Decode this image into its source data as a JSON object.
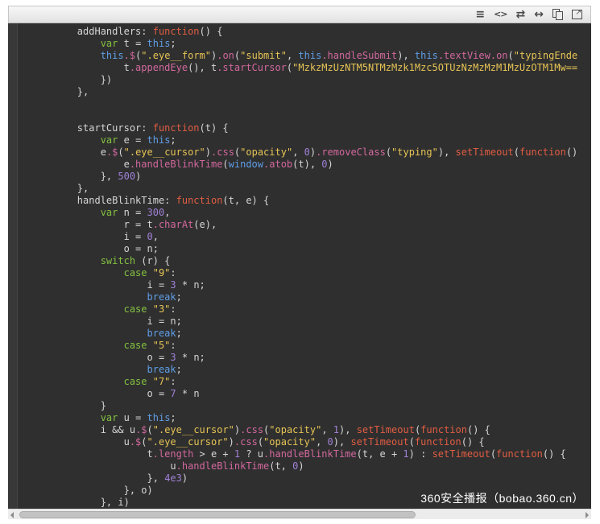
{
  "colors": {
    "bg": "#2f2f2f",
    "plain": "#d6d6d6",
    "keyword": "#e25d43",
    "declaration": "#84c141",
    "builtin": "#5f9ee6",
    "string": "#e6c455",
    "number": "#a081d6",
    "method": "#d2689e",
    "toolbar_bg": "#ececec",
    "watermark": "#ffffff"
  },
  "toolbar": {
    "icons": [
      {
        "name": "line-numbers-icon",
        "glyph": "≡"
      },
      {
        "name": "plain-code-icon",
        "glyph": "<>"
      },
      {
        "name": "toggle-line-wrap-icon",
        "glyph": "⇄"
      },
      {
        "name": "expand-code-icon",
        "glyph": "↔"
      },
      {
        "name": "copy-icon"
      },
      {
        "name": "open-new-window-icon",
        "glyph": "↗"
      }
    ]
  },
  "watermark": {
    "text": "360安全播报（bobao.360.cn）"
  },
  "code": {
    "lines": [
      {
        "indent": 2,
        "tokens": [
          [
            "plain",
            "addHandlers: "
          ],
          [
            "keyword",
            "function"
          ],
          [
            "plain",
            "() {"
          ]
        ]
      },
      {
        "indent": 3,
        "tokens": [
          [
            "declaration",
            "var"
          ],
          [
            "plain",
            " t = "
          ],
          [
            "builtin",
            "this"
          ],
          [
            "plain",
            ";"
          ]
        ]
      },
      {
        "indent": 3,
        "tokens": [
          [
            "builtin",
            "this"
          ],
          [
            "method",
            ".$"
          ],
          [
            "plain",
            "("
          ],
          [
            "string",
            "\".eye__form\""
          ],
          [
            "plain",
            ")"
          ],
          [
            "method",
            ".on"
          ],
          [
            "plain",
            "("
          ],
          [
            "string",
            "\"submit\""
          ],
          [
            "plain",
            ", "
          ],
          [
            "builtin",
            "this"
          ],
          [
            "method",
            ".handleSubmit"
          ],
          [
            "plain",
            "), "
          ],
          [
            "builtin",
            "this"
          ],
          [
            "method",
            ".textView.on"
          ],
          [
            "plain",
            "("
          ],
          [
            "string",
            "\"typingEnde"
          ]
        ]
      },
      {
        "indent": 4,
        "tokens": [
          [
            "plain",
            "t"
          ],
          [
            "method",
            ".appendEye"
          ],
          [
            "plain",
            "(), t"
          ],
          [
            "method",
            ".startCursor"
          ],
          [
            "plain",
            "("
          ],
          [
            "string",
            "\"MzkzMzUzNTM5NTMzMzk1Mzc5OTUzNzMzMzM1MzUzOTM1Mw=="
          ]
        ]
      },
      {
        "indent": 3,
        "tokens": [
          [
            "plain",
            "})"
          ]
        ]
      },
      {
        "indent": 2,
        "tokens": [
          [
            "plain",
            "},"
          ]
        ]
      },
      {
        "indent": 0,
        "tokens": []
      },
      {
        "indent": 0,
        "tokens": []
      },
      {
        "indent": 2,
        "tokens": [
          [
            "plain",
            "startCursor: "
          ],
          [
            "keyword",
            "function"
          ],
          [
            "plain",
            "(t) {"
          ]
        ]
      },
      {
        "indent": 3,
        "tokens": [
          [
            "declaration",
            "var"
          ],
          [
            "plain",
            " e = "
          ],
          [
            "builtin",
            "this"
          ],
          [
            "plain",
            ";"
          ]
        ]
      },
      {
        "indent": 3,
        "tokens": [
          [
            "plain",
            "e"
          ],
          [
            "method",
            ".$"
          ],
          [
            "plain",
            "("
          ],
          [
            "string",
            "\".eye__cursor\""
          ],
          [
            "plain",
            ")"
          ],
          [
            "method",
            ".css"
          ],
          [
            "plain",
            "("
          ],
          [
            "string",
            "\"opacity\""
          ],
          [
            "plain",
            ", "
          ],
          [
            "number",
            "0"
          ],
          [
            "plain",
            ")"
          ],
          [
            "method",
            ".removeClass"
          ],
          [
            "plain",
            "("
          ],
          [
            "string",
            "\"typing\""
          ],
          [
            "plain",
            "), "
          ],
          [
            "keyword",
            "setTimeout"
          ],
          [
            "plain",
            "("
          ],
          [
            "keyword",
            "function"
          ],
          [
            "plain",
            "()"
          ]
        ]
      },
      {
        "indent": 4,
        "tokens": [
          [
            "plain",
            "e"
          ],
          [
            "method",
            ".handleBlinkTime"
          ],
          [
            "plain",
            "("
          ],
          [
            "builtin",
            "window"
          ],
          [
            "method",
            ".atob"
          ],
          [
            "plain",
            "(t), "
          ],
          [
            "number",
            "0"
          ],
          [
            "plain",
            ")"
          ]
        ]
      },
      {
        "indent": 3,
        "tokens": [
          [
            "plain",
            "}, "
          ],
          [
            "number",
            "500"
          ],
          [
            "plain",
            ")"
          ]
        ]
      },
      {
        "indent": 2,
        "tokens": [
          [
            "plain",
            "},"
          ]
        ]
      },
      {
        "indent": 2,
        "tokens": [
          [
            "plain",
            "handleBlinkTime: "
          ],
          [
            "keyword",
            "function"
          ],
          [
            "plain",
            "(t, e) {"
          ]
        ]
      },
      {
        "indent": 3,
        "tokens": [
          [
            "declaration",
            "var"
          ],
          [
            "plain",
            " n = "
          ],
          [
            "number",
            "300"
          ],
          [
            "plain",
            ","
          ]
        ]
      },
      {
        "indent": 4,
        "tokens": [
          [
            "plain",
            "r = t"
          ],
          [
            "method",
            ".charAt"
          ],
          [
            "plain",
            "(e),"
          ]
        ]
      },
      {
        "indent": 4,
        "tokens": [
          [
            "plain",
            "i = "
          ],
          [
            "number",
            "0"
          ],
          [
            "plain",
            ","
          ]
        ]
      },
      {
        "indent": 4,
        "tokens": [
          [
            "plain",
            "o = n;"
          ]
        ]
      },
      {
        "indent": 3,
        "tokens": [
          [
            "declaration",
            "switch"
          ],
          [
            "plain",
            " (r) {"
          ]
        ]
      },
      {
        "indent": 4,
        "tokens": [
          [
            "declaration",
            "case"
          ],
          [
            "plain",
            " "
          ],
          [
            "string",
            "\"9\""
          ],
          [
            "plain",
            ":"
          ]
        ]
      },
      {
        "indent": 5,
        "tokens": [
          [
            "plain",
            "i = "
          ],
          [
            "number",
            "3"
          ],
          [
            "plain",
            " * n;"
          ]
        ]
      },
      {
        "indent": 5,
        "tokens": [
          [
            "builtin",
            "break"
          ],
          [
            "plain",
            ";"
          ]
        ]
      },
      {
        "indent": 4,
        "tokens": [
          [
            "declaration",
            "case"
          ],
          [
            "plain",
            " "
          ],
          [
            "string",
            "\"3\""
          ],
          [
            "plain",
            ":"
          ]
        ]
      },
      {
        "indent": 5,
        "tokens": [
          [
            "plain",
            "i = n;"
          ]
        ]
      },
      {
        "indent": 5,
        "tokens": [
          [
            "builtin",
            "break"
          ],
          [
            "plain",
            ";"
          ]
        ]
      },
      {
        "indent": 4,
        "tokens": [
          [
            "declaration",
            "case"
          ],
          [
            "plain",
            " "
          ],
          [
            "string",
            "\"5\""
          ],
          [
            "plain",
            ":"
          ]
        ]
      },
      {
        "indent": 5,
        "tokens": [
          [
            "plain",
            "o = "
          ],
          [
            "number",
            "3"
          ],
          [
            "plain",
            " * n;"
          ]
        ]
      },
      {
        "indent": 5,
        "tokens": [
          [
            "builtin",
            "break"
          ],
          [
            "plain",
            ";"
          ]
        ]
      },
      {
        "indent": 4,
        "tokens": [
          [
            "declaration",
            "case"
          ],
          [
            "plain",
            " "
          ],
          [
            "string",
            "\"7\""
          ],
          [
            "plain",
            ":"
          ]
        ]
      },
      {
        "indent": 5,
        "tokens": [
          [
            "plain",
            "o = "
          ],
          [
            "number",
            "7"
          ],
          [
            "plain",
            " * n"
          ]
        ]
      },
      {
        "indent": 3,
        "tokens": [
          [
            "plain",
            "}"
          ]
        ]
      },
      {
        "indent": 3,
        "tokens": [
          [
            "declaration",
            "var"
          ],
          [
            "plain",
            " u = "
          ],
          [
            "builtin",
            "this"
          ],
          [
            "plain",
            ";"
          ]
        ]
      },
      {
        "indent": 3,
        "tokens": [
          [
            "plain",
            "i && u"
          ],
          [
            "method",
            ".$"
          ],
          [
            "plain",
            "("
          ],
          [
            "string",
            "\".eye__cursor\""
          ],
          [
            "plain",
            ")"
          ],
          [
            "method",
            ".css"
          ],
          [
            "plain",
            "("
          ],
          [
            "string",
            "\"opacity\""
          ],
          [
            "plain",
            ", "
          ],
          [
            "number",
            "1"
          ],
          [
            "plain",
            "), "
          ],
          [
            "keyword",
            "setTimeout"
          ],
          [
            "plain",
            "("
          ],
          [
            "keyword",
            "function"
          ],
          [
            "plain",
            "() {"
          ]
        ]
      },
      {
        "indent": 4,
        "tokens": [
          [
            "plain",
            "u"
          ],
          [
            "method",
            ".$"
          ],
          [
            "plain",
            "("
          ],
          [
            "string",
            "\".eye__cursor\""
          ],
          [
            "plain",
            ")"
          ],
          [
            "method",
            ".css"
          ],
          [
            "plain",
            "("
          ],
          [
            "string",
            "\"opacity\""
          ],
          [
            "plain",
            ", "
          ],
          [
            "number",
            "0"
          ],
          [
            "plain",
            "), "
          ],
          [
            "keyword",
            "setTimeout"
          ],
          [
            "plain",
            "("
          ],
          [
            "keyword",
            "function"
          ],
          [
            "plain",
            "() {"
          ]
        ]
      },
      {
        "indent": 5,
        "tokens": [
          [
            "plain",
            "t"
          ],
          [
            "method",
            ".length"
          ],
          [
            "plain",
            " > e + "
          ],
          [
            "number",
            "1"
          ],
          [
            "plain",
            " ? u"
          ],
          [
            "method",
            ".handleBlinkTime"
          ],
          [
            "plain",
            "(t, e + "
          ],
          [
            "number",
            "1"
          ],
          [
            "plain",
            ") : "
          ],
          [
            "keyword",
            "setTimeout"
          ],
          [
            "plain",
            "("
          ],
          [
            "keyword",
            "function"
          ],
          [
            "plain",
            "() {"
          ]
        ]
      },
      {
        "indent": 6,
        "tokens": [
          [
            "plain",
            "u"
          ],
          [
            "method",
            ".handleBlinkTime"
          ],
          [
            "plain",
            "(t, "
          ],
          [
            "number",
            "0"
          ],
          [
            "plain",
            ")"
          ]
        ]
      },
      {
        "indent": 5,
        "tokens": [
          [
            "plain",
            "}, "
          ],
          [
            "number",
            "4e3"
          ],
          [
            "plain",
            ")"
          ]
        ]
      },
      {
        "indent": 4,
        "tokens": [
          [
            "plain",
            "}, o)"
          ]
        ]
      },
      {
        "indent": 3,
        "tokens": [
          [
            "plain",
            "}, i)"
          ]
        ]
      }
    ]
  }
}
